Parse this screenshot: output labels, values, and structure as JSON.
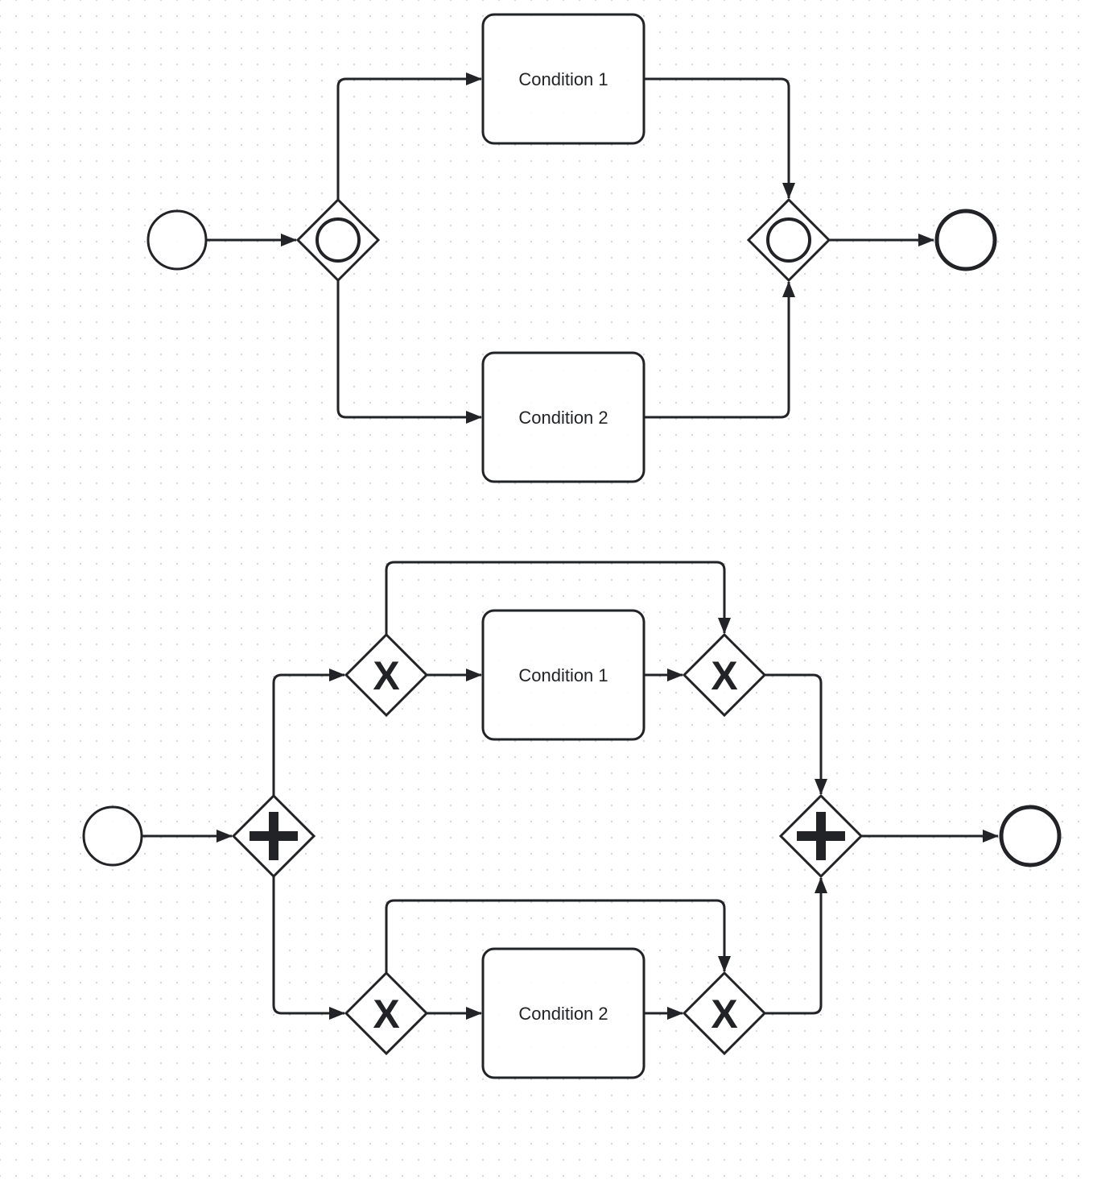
{
  "diagram_type": "BPMN",
  "colors": {
    "stroke": "#222326",
    "background": "#ffffff",
    "grid_dot": "#d4d4d6"
  },
  "diagrams": [
    {
      "name": "inclusive-gateway-flow",
      "nodes": [
        {
          "id": "start1",
          "type": "start-event"
        },
        {
          "id": "split1",
          "type": "inclusive-gateway"
        },
        {
          "id": "task1",
          "type": "task",
          "label": "Condition 1"
        },
        {
          "id": "task2",
          "type": "task",
          "label": "Condition 2"
        },
        {
          "id": "join1",
          "type": "inclusive-gateway"
        },
        {
          "id": "end1",
          "type": "end-event"
        }
      ],
      "flows": [
        [
          "start1",
          "split1"
        ],
        [
          "split1",
          "task1"
        ],
        [
          "split1",
          "task2"
        ],
        [
          "task1",
          "join1"
        ],
        [
          "task2",
          "join1"
        ],
        [
          "join1",
          "end1"
        ]
      ]
    },
    {
      "name": "parallel-exclusive-gateway-flow",
      "nodes": [
        {
          "id": "start2",
          "type": "start-event"
        },
        {
          "id": "psplit",
          "type": "parallel-gateway"
        },
        {
          "id": "x1",
          "type": "exclusive-gateway"
        },
        {
          "id": "task3",
          "type": "task",
          "label": "Condition 1"
        },
        {
          "id": "x2",
          "type": "exclusive-gateway"
        },
        {
          "id": "x3",
          "type": "exclusive-gateway"
        },
        {
          "id": "task4",
          "type": "task",
          "label": "Condition 2"
        },
        {
          "id": "x4",
          "type": "exclusive-gateway"
        },
        {
          "id": "pjoin",
          "type": "parallel-gateway"
        },
        {
          "id": "end2",
          "type": "end-event"
        }
      ],
      "flows": [
        [
          "start2",
          "psplit"
        ],
        [
          "psplit",
          "x1"
        ],
        [
          "psplit",
          "x3"
        ],
        [
          "x1",
          "task3"
        ],
        [
          "x1",
          "x2"
        ],
        [
          "task3",
          "x2"
        ],
        [
          "x2",
          "pjoin"
        ],
        [
          "x3",
          "task4"
        ],
        [
          "x3",
          "x4"
        ],
        [
          "task4",
          "x4"
        ],
        [
          "x4",
          "pjoin"
        ],
        [
          "pjoin",
          "end2"
        ]
      ]
    }
  ],
  "labels": {
    "top_task1": "Condition 1",
    "top_task2": "Condition 2",
    "bottom_task1": "Condition 1",
    "bottom_task2": "Condition 2",
    "gateway_x": "X"
  }
}
